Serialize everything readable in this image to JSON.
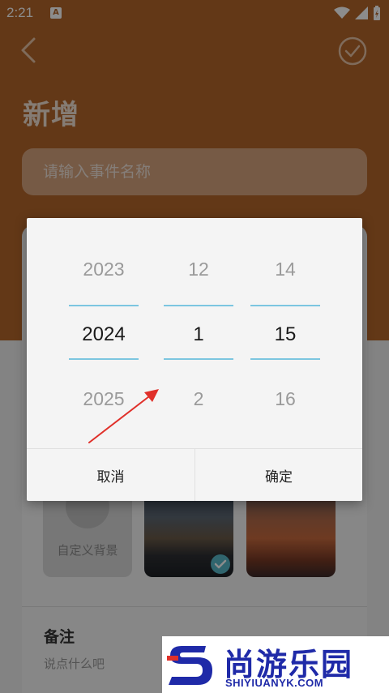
{
  "status_bar": {
    "time": "2:21",
    "app_badge": "A"
  },
  "page": {
    "title": "新增",
    "name_input_placeholder": "请输入事件名称",
    "custom_bg_label": "自定义背景",
    "note_title": "备注",
    "note_placeholder": "说点什么吧"
  },
  "picker": {
    "year": {
      "prev": "2023",
      "selected": "2024",
      "next": "2025"
    },
    "month": {
      "prev": "12",
      "selected": "1",
      "next": "2"
    },
    "day": {
      "prev": "14",
      "selected": "15",
      "next": "16"
    },
    "cancel_label": "取消",
    "confirm_label": "确定"
  },
  "watermark": {
    "brand_cn": "尚游乐园",
    "brand_en": "SHIYIUANYK.COM"
  },
  "colors": {
    "header_bg": "#b5662a",
    "picker_line": "#7cc6e0",
    "annotation_arrow": "#e0302a",
    "watermark_blue": "#1f2aa8"
  }
}
